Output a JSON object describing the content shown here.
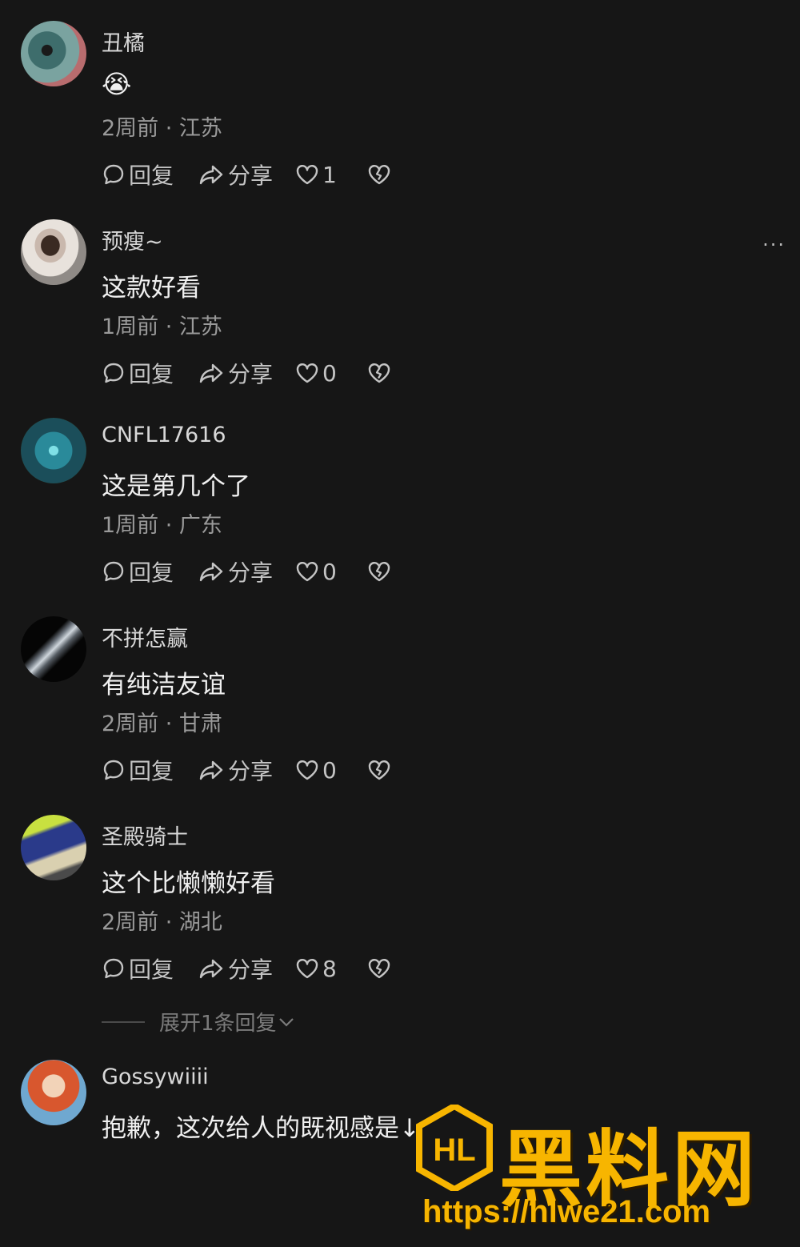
{
  "comments": [
    {
      "username": "丑橘",
      "text": "😭",
      "meta": "2周前 · 江苏",
      "reply": "回复",
      "share": "分享",
      "likes": "1"
    },
    {
      "username": "预瘦~",
      "text": "这款好看",
      "meta": "1周前 · 江苏",
      "reply": "回复",
      "share": "分享",
      "likes": "0"
    },
    {
      "username": "CNFL17616",
      "text": "这是第几个了",
      "meta": "1周前 · 广东",
      "reply": "回复",
      "share": "分享",
      "likes": "0"
    },
    {
      "username": "不拼怎赢",
      "text": "有纯洁友谊",
      "meta": "2周前 · 甘肃",
      "reply": "回复",
      "share": "分享",
      "likes": "0"
    },
    {
      "username": "圣殿骑士",
      "text": "这个比懒懒好看",
      "meta": "2周前 · 湖北",
      "reply": "回复",
      "share": "分享",
      "likes": "8"
    },
    {
      "username": "Gossywiiii",
      "text": "抱歉，这次给人的既视感是↓"
    }
  ],
  "expand_label": "展开1条回复",
  "more_label": "···",
  "watermark": {
    "brand": "黑料网",
    "url": "https://hlwe21.com",
    "logo": "HL"
  },
  "colors": {
    "background": "#161616",
    "watermark": "#f7b500"
  }
}
